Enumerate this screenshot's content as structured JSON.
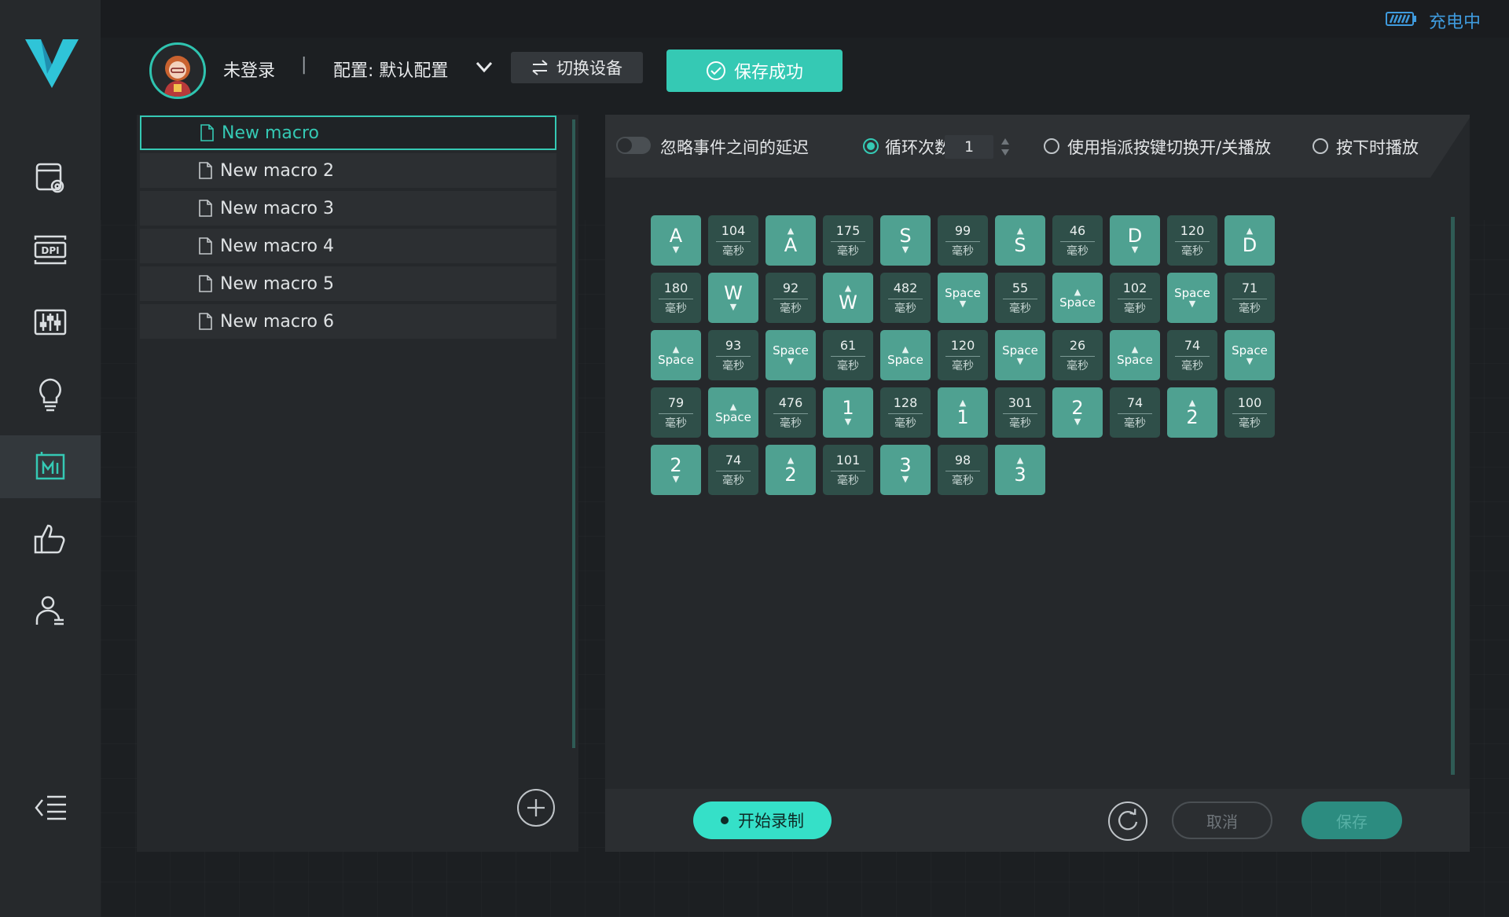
{
  "titlebar": {
    "charge_status": "充电中"
  },
  "header": {
    "login_status": "未登录",
    "separator": "|",
    "config_label": "配置: 默认配置",
    "switch_device": "切换设备",
    "save_status": "保存成功"
  },
  "sidebar": {
    "items": [
      {
        "icon": "camera-settings-icon"
      },
      {
        "icon": "dpi-icon",
        "label": "DPI"
      },
      {
        "icon": "equalizer-icon"
      },
      {
        "icon": "lightbulb-icon"
      },
      {
        "icon": "macro-icon",
        "label": "M",
        "active": true
      },
      {
        "icon": "thumbs-up-icon"
      },
      {
        "icon": "user-settings-icon"
      }
    ],
    "collapse_icon": "collapse-menu-icon"
  },
  "macros": [
    {
      "label": "New macro",
      "selected": true
    },
    {
      "label": "New macro 2"
    },
    {
      "label": "New macro 3"
    },
    {
      "label": "New macro 4"
    },
    {
      "label": "New macro 5"
    },
    {
      "label": "New macro 6"
    }
  ],
  "options": {
    "ignore_delay": "忽略事件之间的延迟",
    "loop_count_label": "循环次数",
    "loop_count_value": "1",
    "toggle_playback": "使用指派按键切换开/关播放",
    "hold_playback": "按下时播放"
  },
  "steps_per_row": 11,
  "delay_unit": "毫秒",
  "steps": [
    {
      "t": "down",
      "k": "A"
    },
    {
      "t": "delay",
      "v": "104"
    },
    {
      "t": "up",
      "k": "A"
    },
    {
      "t": "delay",
      "v": "175"
    },
    {
      "t": "down",
      "k": "S"
    },
    {
      "t": "delay",
      "v": "99"
    },
    {
      "t": "up",
      "k": "S"
    },
    {
      "t": "delay",
      "v": "46"
    },
    {
      "t": "down",
      "k": "D"
    },
    {
      "t": "delay",
      "v": "120"
    },
    {
      "t": "up",
      "k": "D"
    },
    {
      "t": "delay",
      "v": "180"
    },
    {
      "t": "down",
      "k": "W"
    },
    {
      "t": "delay",
      "v": "92"
    },
    {
      "t": "up",
      "k": "W"
    },
    {
      "t": "delay",
      "v": "482"
    },
    {
      "t": "down",
      "k": "Space"
    },
    {
      "t": "delay",
      "v": "55"
    },
    {
      "t": "up",
      "k": "Space"
    },
    {
      "t": "delay",
      "v": "102"
    },
    {
      "t": "down",
      "k": "Space"
    },
    {
      "t": "delay",
      "v": "71"
    },
    {
      "t": "up",
      "k": "Space"
    },
    {
      "t": "delay",
      "v": "93"
    },
    {
      "t": "down",
      "k": "Space"
    },
    {
      "t": "delay",
      "v": "61"
    },
    {
      "t": "up",
      "k": "Space"
    },
    {
      "t": "delay",
      "v": "120"
    },
    {
      "t": "down",
      "k": "Space"
    },
    {
      "t": "delay",
      "v": "26"
    },
    {
      "t": "up",
      "k": "Space"
    },
    {
      "t": "delay",
      "v": "74"
    },
    {
      "t": "down",
      "k": "Space"
    },
    {
      "t": "delay",
      "v": "79"
    },
    {
      "t": "up",
      "k": "Space"
    },
    {
      "t": "delay",
      "v": "476"
    },
    {
      "t": "down",
      "k": "1"
    },
    {
      "t": "delay",
      "v": "128"
    },
    {
      "t": "up",
      "k": "1"
    },
    {
      "t": "delay",
      "v": "301"
    },
    {
      "t": "down",
      "k": "2"
    },
    {
      "t": "delay",
      "v": "74"
    },
    {
      "t": "up",
      "k": "2"
    },
    {
      "t": "delay",
      "v": "100"
    },
    {
      "t": "down",
      "k": "2"
    },
    {
      "t": "delay",
      "v": "74"
    },
    {
      "t": "up",
      "k": "2"
    },
    {
      "t": "delay",
      "v": "101"
    },
    {
      "t": "down",
      "k": "3"
    },
    {
      "t": "delay",
      "v": "98"
    },
    {
      "t": "up",
      "k": "3"
    }
  ],
  "footer": {
    "record": "开始录制",
    "cancel": "取消",
    "save": "保存"
  },
  "colors": {
    "accent": "#35c9b4",
    "key_step": "#4fa191",
    "delay_step": "#2f4f49",
    "charge_text": "#3f9bde"
  }
}
